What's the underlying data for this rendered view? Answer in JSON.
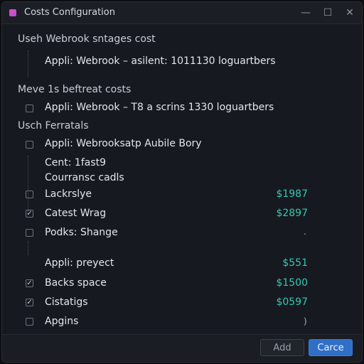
{
  "window": {
    "title": "Costs Configuration",
    "controls": {
      "minimize": "—",
      "maximize": "☐",
      "close": "✕"
    }
  },
  "sections": {
    "s1": "Useh Webrook sntages cost",
    "s2": "Meve 1s beftreat costs",
    "s3": "Usch Ferratals"
  },
  "lines": {
    "l1": "Appli: Webrook – asilent: 1011130 loguartbers",
    "l2": "Appli: Webrook – T8 a scrins 1330 loguartbers",
    "l3": "Appli: Webrooksatp Aubile Bory",
    "l4": "Cent: 1fast9",
    "l5": "Courransc cadls"
  },
  "items": [
    {
      "label": "Lackrslye",
      "amount": "$1987",
      "checked": false
    },
    {
      "label": "Catest Wrag",
      "amount": "$2897",
      "checked": true
    },
    {
      "label": "Podks: Shange",
      "amount": "",
      "checked": false,
      "trail": "."
    },
    {
      "label": "Appli: preyect",
      "amount": "$551",
      "checked": false
    },
    {
      "label": "Backs space",
      "amount": "$1500",
      "checked": true
    },
    {
      "label": "Cistatigs",
      "amount": "$0597",
      "checked": true
    },
    {
      "label": "Apgins",
      "amount": "",
      "checked": false,
      "trail": ")"
    }
  ],
  "footer": {
    "add_label": "Add",
    "cancel_label": "Carce"
  },
  "colors": {
    "accent": "#2f6fc8",
    "amount": "#35c7b4",
    "app_icon": "#d24fc4"
  },
  "icons": {
    "app": "app-icon",
    "minimize": "minimize-icon",
    "maximize": "maximize-icon",
    "close": "close-icon"
  }
}
